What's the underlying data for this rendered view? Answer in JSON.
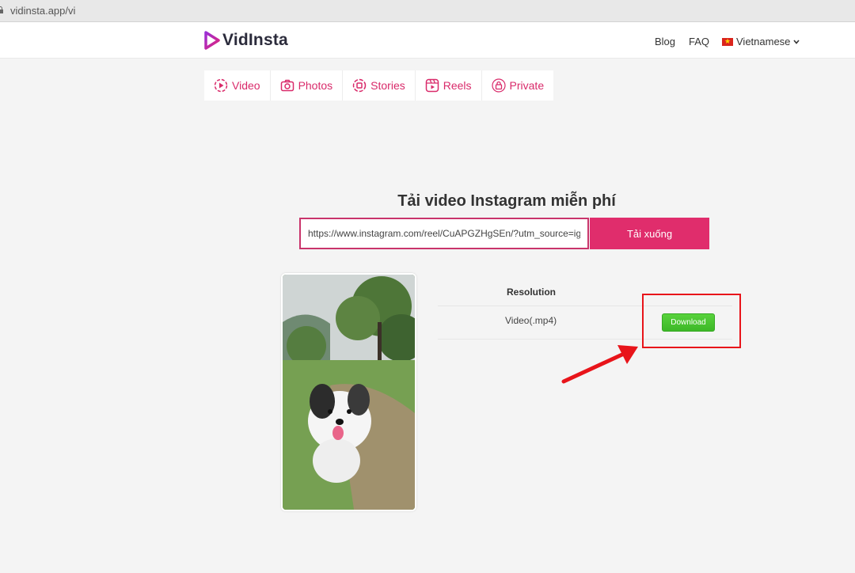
{
  "browser": {
    "url": "vidinsta.app/vi"
  },
  "header": {
    "logo": "VidInsta",
    "nav": {
      "blog": "Blog",
      "faq": "FAQ",
      "language": "Vietnamese"
    }
  },
  "tabs": [
    {
      "label": "Video",
      "icon": "play-circle-icon"
    },
    {
      "label": "Photos",
      "icon": "camera-icon"
    },
    {
      "label": "Stories",
      "icon": "stories-icon"
    },
    {
      "label": "Reels",
      "icon": "reels-icon"
    },
    {
      "label": "Private",
      "icon": "lock-icon"
    }
  ],
  "main": {
    "title": "Tải video Instagram miễn phí",
    "input_value": "https://www.instagram.com/reel/CuAPGZHgSEn/?utm_source=ig_we",
    "submit_label": "Tải xuống"
  },
  "result": {
    "column_header": "Resolution",
    "rows": [
      {
        "resolution": "Video(.mp4)",
        "action": "Download"
      }
    ]
  },
  "colors": {
    "accent": "#e02d6c",
    "download_green": "#45c42e",
    "highlight_red": "#e8141a"
  }
}
